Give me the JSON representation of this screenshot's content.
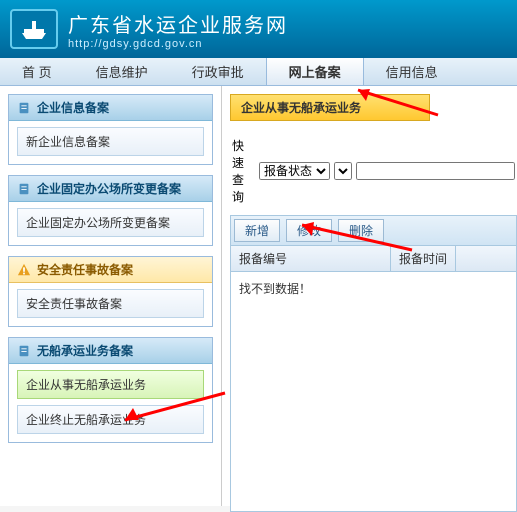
{
  "header": {
    "title": "广东省水运企业服务网",
    "url": "http://gdsy.gdcd.gov.cn"
  },
  "nav": [
    {
      "label": "首 页",
      "active": false
    },
    {
      "label": "信息维护",
      "active": false
    },
    {
      "label": "行政审批",
      "active": false
    },
    {
      "label": "网上备案",
      "active": true
    },
    {
      "label": "信用信息",
      "active": false
    }
  ],
  "sidebar": {
    "panels": [
      {
        "title": "企业信息备案",
        "icon": "doc",
        "items": [
          {
            "label": "新企业信息备案",
            "active": false
          }
        ]
      },
      {
        "title": "企业固定办公场所变更备案",
        "icon": "doc",
        "items": [
          {
            "label": "企业固定办公场所变更备案",
            "active": false
          }
        ]
      },
      {
        "title": "安全责任事故备案",
        "icon": "warn",
        "items": [
          {
            "label": "安全责任事故备案",
            "active": false
          }
        ]
      },
      {
        "title": "无船承运业务备案",
        "icon": "doc",
        "items": [
          {
            "label": "企业从事无船承运业务",
            "active": true
          },
          {
            "label": "企业终止无船承运业务",
            "active": false
          }
        ]
      }
    ]
  },
  "content": {
    "title": "企业从事无船承运业务",
    "quick_query_label": "快速查询",
    "query_select_option": "报备状态",
    "toolbar": {
      "add": "新增",
      "edit": "修改",
      "delete": "删除"
    },
    "columns": [
      "报备编号",
      "报备时间"
    ],
    "empty_text": "找不到数据！"
  }
}
